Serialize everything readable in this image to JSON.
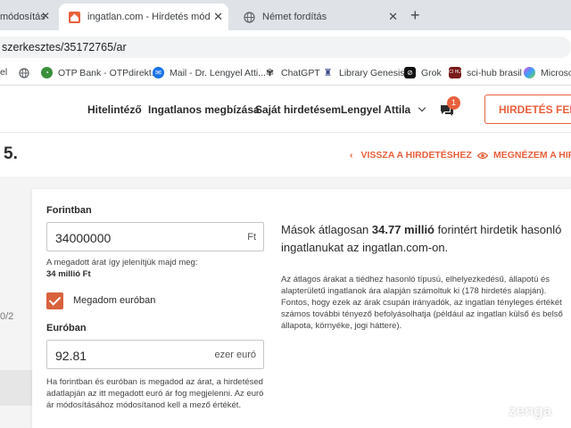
{
  "browser": {
    "tabs": [
      {
        "title": "módosítás"
      },
      {
        "title": "ingatlan.com - Hirdetés módosítás"
      },
      {
        "title": "Német fordítás"
      }
    ],
    "new_tab": "+",
    "url": "szerkesztes/35172765/ar",
    "bookmarks": [
      {
        "label": "el"
      },
      {
        "label": ""
      },
      {
        "label": "OTP Bank - OTPdirekt..."
      },
      {
        "label": "Mail - Dr. Lengyel Atti..."
      },
      {
        "label": "ChatGPT"
      },
      {
        "label": "Library Genesis"
      },
      {
        "label": "Grok"
      },
      {
        "label": "sci-hub brasil",
        "icon_text": "SCI HUB"
      },
      {
        "label": "Microsof"
      }
    ]
  },
  "site": {
    "nav": [
      "Hitelintéző",
      "Ingatlanos megbízása",
      "Saját hirdetésem"
    ],
    "user": "Lengyel Attila",
    "messages_count": "1",
    "cta": "HIRDETÉS FELA",
    "accent": "#e8603c"
  },
  "subheader": {
    "page_number": "5.",
    "back": "VISSZA A HIRDETÉSHEZ",
    "view": "MEGNÉZEM A HIRD"
  },
  "sidebar": {
    "fragment": "0/2"
  },
  "form": {
    "huf_label": "Forintban",
    "huf_value": "34000000",
    "huf_unit": "Ft",
    "huf_note": "A megadott árat így jelenítjük majd meg:",
    "huf_display": "34 millió Ft",
    "eur_checkbox_label": "Megadom euróban",
    "eur_checked": true,
    "eur_label": "Euróban",
    "eur_value": "92.81",
    "eur_unit": "ezer euró",
    "eur_note": "Ha forintban és euróban is megadod az árat, a hirdetésed adatlapján az itt megadott euró ár fog megjelenni. Az euró ár módosításához módosítanod kell a mező értékét."
  },
  "info": {
    "avg_pre": "Mások átlagosan ",
    "avg_value": "34.77 millió",
    "avg_post": " forintért hirdetik hasonló ingatlanukat az ingatlan.com-on.",
    "explain": "Az átlagos árakat a tiédhez hasonló típusú, elhelyezkedésű, állapotú és alapterületű ingatlanok ára alapján számoltuk ki (178 hirdetés alapján). Fontos, hogy ezek az árak csupán irányadók, az ingatlan tényleges értékét számos további tényező befolyásolhatja (például az ingatlan külső és belső állapota, környéke, jogi háttere)."
  },
  "watermark": "zenga"
}
